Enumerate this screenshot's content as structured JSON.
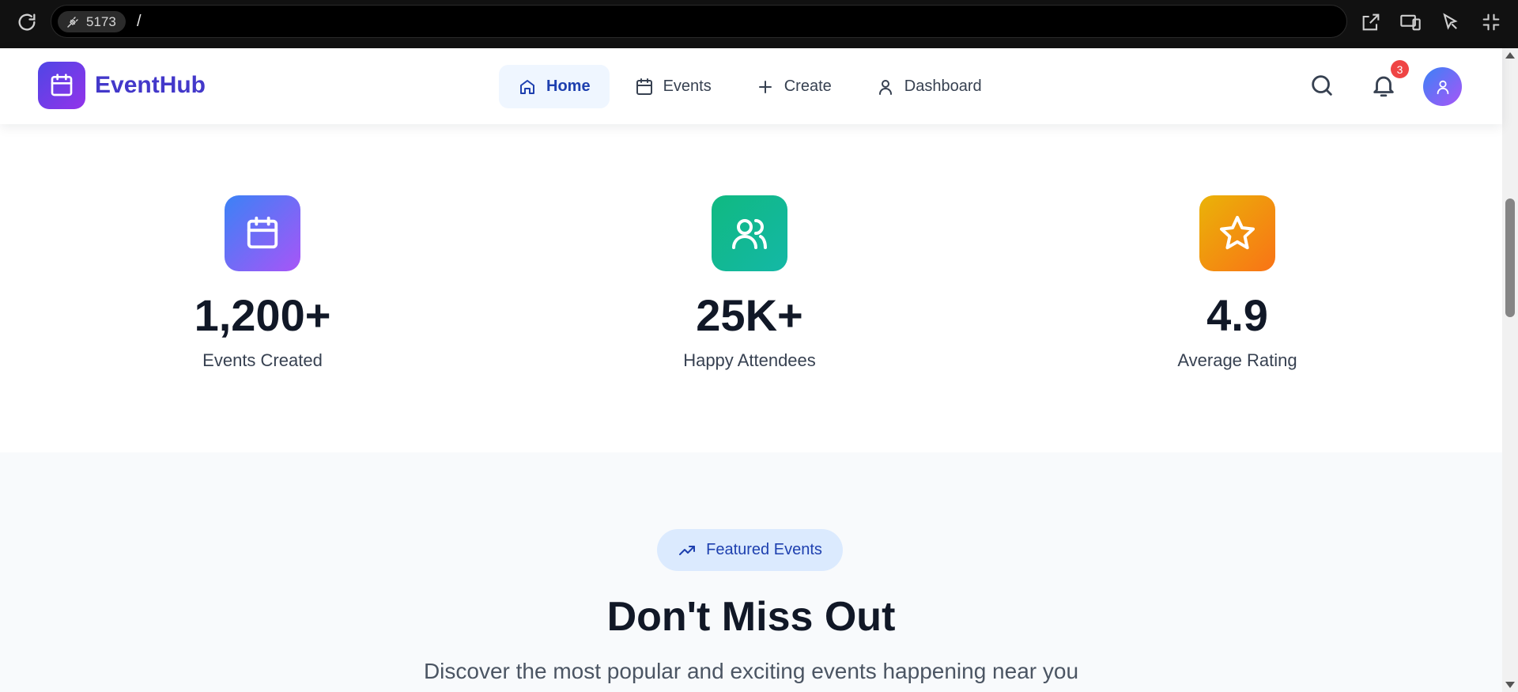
{
  "browser": {
    "port": "5173",
    "path": "/"
  },
  "brand": {
    "name": "EventHub"
  },
  "nav": {
    "items": [
      {
        "label": "Home",
        "icon": "home-icon",
        "active": true
      },
      {
        "label": "Events",
        "icon": "calendar-icon",
        "active": false
      },
      {
        "label": "Create",
        "icon": "plus-icon",
        "active": false
      },
      {
        "label": "Dashboard",
        "icon": "user-icon",
        "active": false
      }
    ]
  },
  "header": {
    "notification_count": "3"
  },
  "stats": [
    {
      "value": "1,200+",
      "label": "Events Created",
      "icon": "calendar-icon",
      "gradient": [
        "#3b82f6",
        "#a855f7"
      ]
    },
    {
      "value": "25K+",
      "label": "Happy Attendees",
      "icon": "users-icon",
      "gradient": [
        "#10b981",
        "#14b8a6"
      ]
    },
    {
      "value": "4.9",
      "label": "Average Rating",
      "icon": "star-icon",
      "gradient": [
        "#eab308",
        "#f97316"
      ]
    }
  ],
  "featured": {
    "badge": "Featured Events",
    "heading": "Don't Miss Out",
    "subheading": "Discover the most popular and exciting events happening near you"
  },
  "colors": {
    "brand": "#4338ca",
    "accent_blue": "#1e40af",
    "badge_red": "#ef4444"
  }
}
